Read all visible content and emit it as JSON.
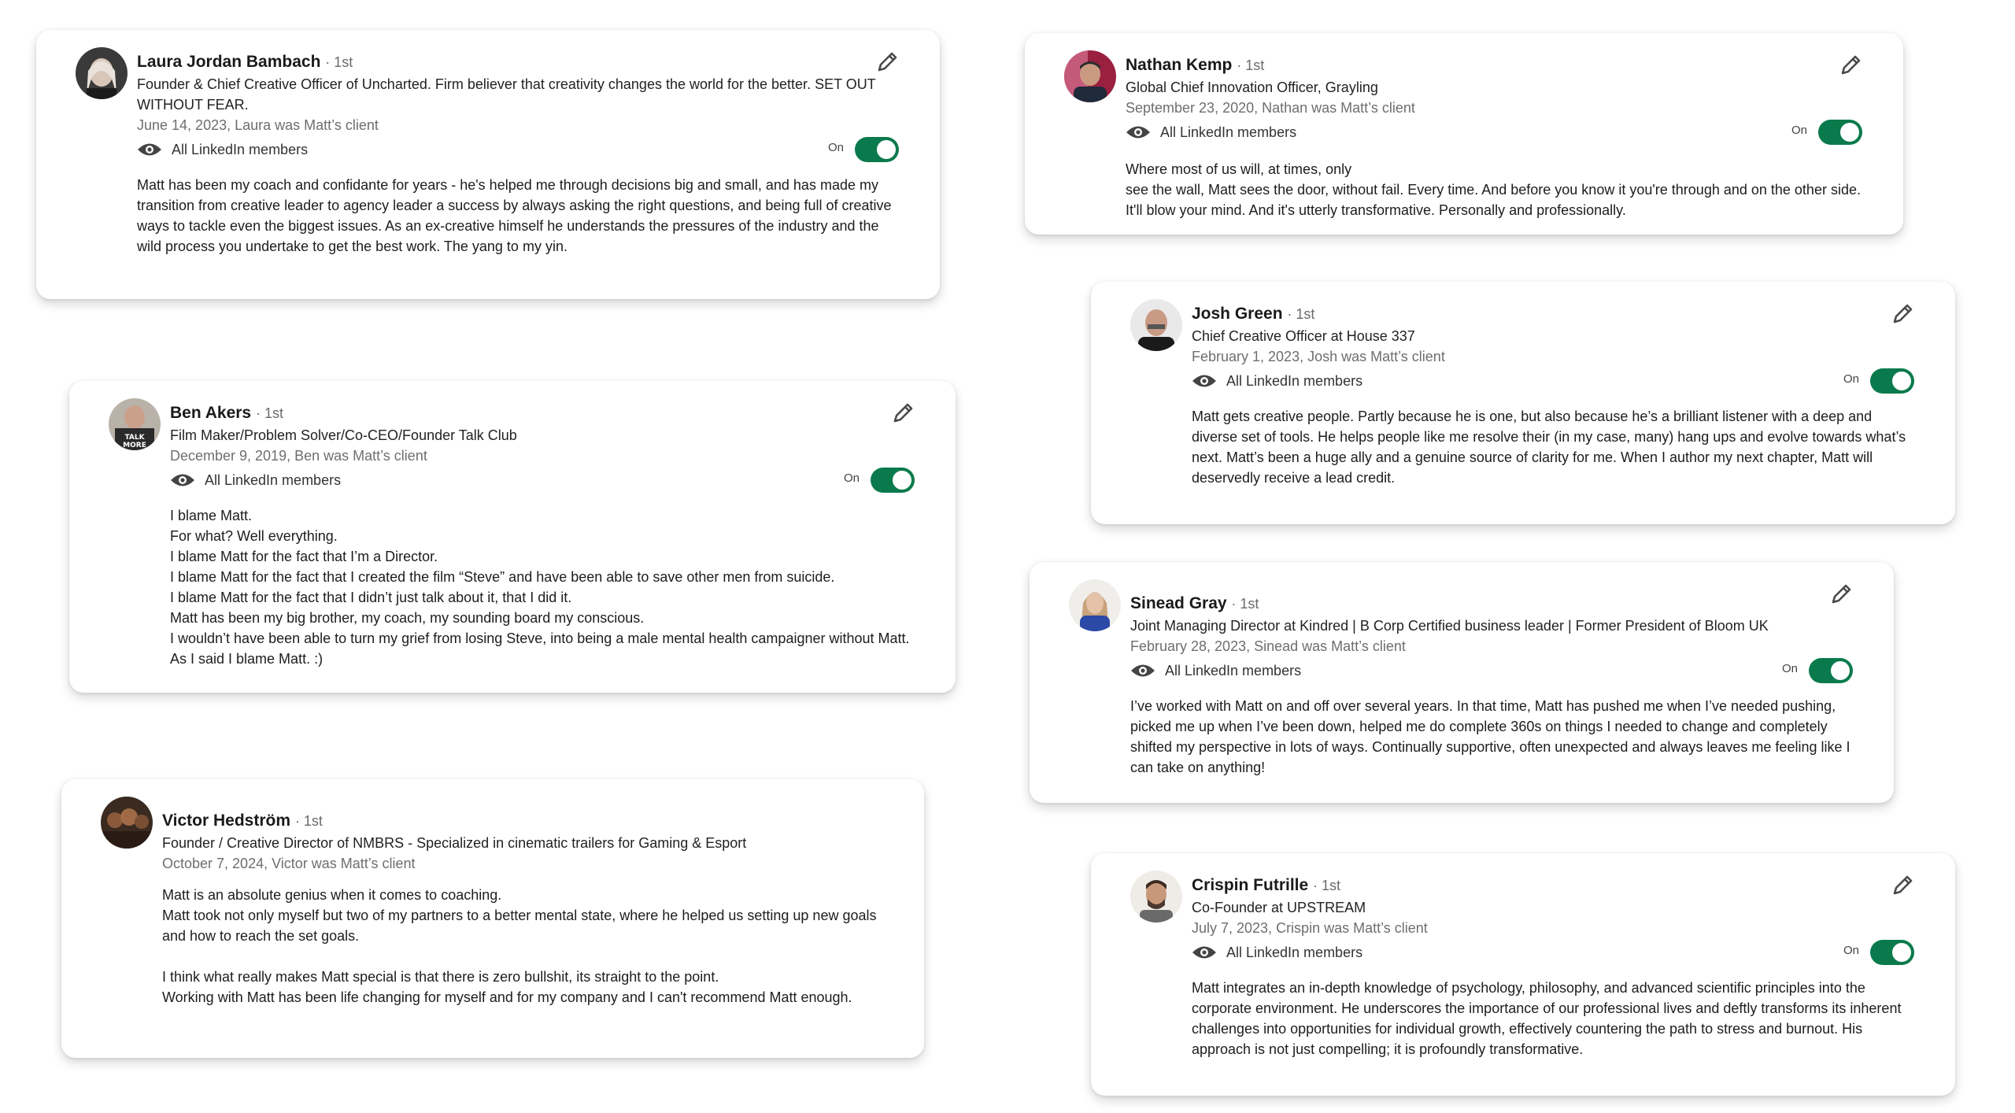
{
  "cards": [
    {
      "name": "Laura Jordan Bambach",
      "degree": "· 1st",
      "headline": "Founder & Chief Creative Officer of Uncharted. Firm believer that creativity changes the world for the better. SET OUT WITHOUT FEAR.",
      "date": "June 14, 2023, Laura was Matt’s client",
      "visibility": "All LinkedIn members",
      "toggle_label": "On",
      "text": "Matt has been my coach and confidante for years - he's helped me through decisions big and small, and has made my transition from creative leader to agency leader a success by always asking the right questions, and being full of creative ways to tackle even the biggest issues. As an ex-creative himself he understands the pressures of the industry and the wild process you undertake to get the best work. The yang to my yin."
    },
    {
      "name": "Nathan Kemp",
      "degree": "· 1st",
      "headline": "Global Chief Innovation Officer, Grayling",
      "date": "September 23, 2020, Nathan was Matt’s client",
      "visibility": "All LinkedIn members",
      "toggle_label": "On",
      "text": "Where most of us will, at times, only\nsee the wall, Matt sees the door, without fail. Every time. And before you know it you're through and on the other side. It'll blow your mind. And it's utterly transformative. Personally and professionally."
    },
    {
      "name": "Josh Green",
      "degree": "· 1st",
      "headline": "Chief Creative Officer at House 337",
      "date": "February 1, 2023, Josh was Matt’s client",
      "visibility": "All LinkedIn members",
      "toggle_label": "On",
      "text": "Matt gets creative people. Partly because he is one, but also because he’s a brilliant listener with a deep and diverse set of tools. He helps people like me resolve their (in my case, many) hang ups and evolve towards what’s next. Matt’s been a huge ally and a genuine source of clarity for me. When I author my next chapter, Matt will deservedly receive a lead credit."
    },
    {
      "name": "Ben Akers",
      "degree": "· 1st",
      "headline": "Film Maker/Problem Solver/Co-CEO/Founder Talk Club",
      "date": "December 9, 2019, Ben was Matt’s client",
      "visibility": "All LinkedIn members",
      "toggle_label": "On",
      "text": "I blame Matt.\nFor what? Well everything.\nI blame Matt for the fact that I’m a Director.\nI blame Matt for the fact that I created the film “Steve” and have been able to save other men from suicide.\nI blame Matt for the fact that I didn’t just talk about it, that I did it.\nMatt has been my big brother, my coach, my sounding board my conscious.\nI wouldn’t have been able to turn my grief from losing Steve, into being a male mental health campaigner without Matt. As I said I blame Matt. :)"
    },
    {
      "name": "Sinead Gray",
      "degree": "· 1st",
      "headline": "Joint Managing Director at Kindred | B Corp Certified business leader | Former President of Bloom UK",
      "date": "February 28, 2023, Sinead was Matt’s client",
      "visibility": "All LinkedIn members",
      "toggle_label": "On",
      "text": "I’ve worked with Matt on and off over several years. In that time, Matt has pushed me when I’ve needed pushing, picked me up when I’ve been down, helped me do complete 360s on things I needed to change and completely shifted my perspective in lots of ways. Continually supportive, often unexpected and always leaves me feeling like I can take on anything!"
    },
    {
      "name": "Victor Hedström",
      "degree": "· 1st",
      "headline": "Founder / Creative Director of NMBRS - Specialized in cinematic trailers for Gaming & Esport",
      "date": "October 7, 2024, Victor was Matt’s client",
      "text": "Matt is an absolute genius when it comes to coaching.\nMatt took not only myself but two of my partners to a better mental state, where he helped us setting up new goals and how to reach the set goals.\n\nI think what really makes Matt special is that there is zero bullshit, its straight to the point.\nWorking with Matt has been life changing for myself and for my company and I can't recommend Matt enough."
    },
    {
      "name": "Crispin Futrille",
      "degree": "· 1st",
      "headline": "Co-Founder at UPSTREAM",
      "date": "July 7, 2023, Crispin was Matt’s client",
      "visibility": "All LinkedIn members",
      "toggle_label": "On",
      "text": "Matt integrates an in-depth knowledge of psychology, philosophy, and advanced scientific principles into the corporate environment. He underscores the importance of our professional lives and deftly transforms its inherent challenges into opportunities for individual growth, effectively countering the path to stress and burnout. His approach is not just compelling; it is profoundly transformative."
    }
  ],
  "icons": {
    "edit": "pencil-icon",
    "visibility": "eye-icon"
  },
  "colors": {
    "toggle_on": "#0a7a4c"
  }
}
